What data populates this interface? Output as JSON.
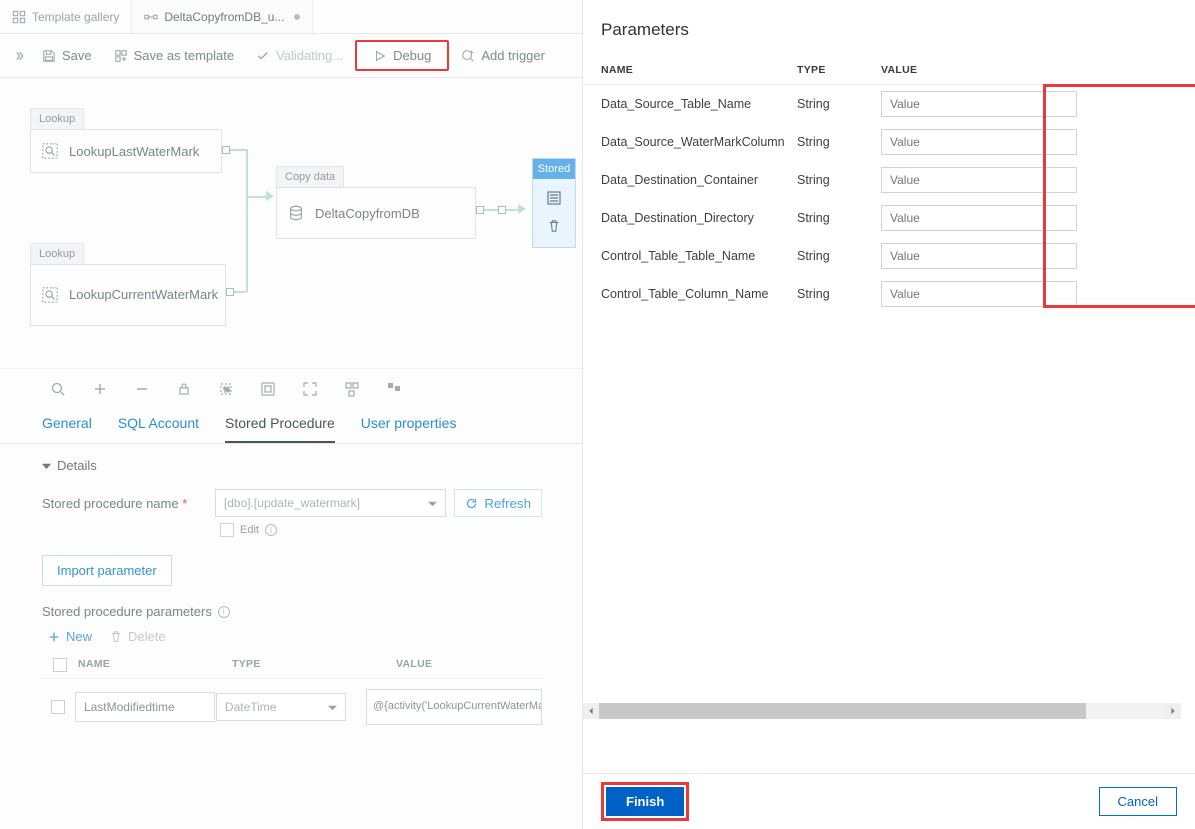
{
  "tabs": {
    "gallery": "Template gallery",
    "pipeline": "DeltaCopyfromDB_u..."
  },
  "toolbar": {
    "save": "Save",
    "save_template": "Save as template",
    "validating": "Validating...",
    "debug": "Debug",
    "add_trigger": "Add trigger"
  },
  "canvas": {
    "lookup_label": "Lookup",
    "lookup_last": "LookupLastWaterMark",
    "lookup_current": "LookupCurrentWaterMark",
    "copy_label": "Copy data",
    "copy_name": "DeltaCopyfromDB",
    "stored_label": "Stored"
  },
  "prop_tabs": {
    "general": "General",
    "sql": "SQL Account",
    "sproc": "Stored Procedure",
    "user": "User properties"
  },
  "details": {
    "header": "Details",
    "sp_name_label": "Stored procedure name",
    "sp_name_value": "[dbo].[update_watermark]",
    "edit": "Edit",
    "refresh": "Refresh",
    "import": "Import parameter",
    "sp_params_label": "Stored procedure parameters",
    "new": "New",
    "delete": "Delete",
    "col_name": "NAME",
    "col_type": "TYPE",
    "col_value": "VALUE",
    "row": {
      "name": "LastModifiedtime",
      "type": "DateTime",
      "value": "@{activity('LookupCurrentWaterMark').output.firstRow.NewWatermarkValue}"
    }
  },
  "panel": {
    "title": "Parameters",
    "col_name": "NAME",
    "col_type": "TYPE",
    "col_value": "VALUE",
    "placeholder": "Value",
    "rows": [
      {
        "name": "Data_Source_Table_Name",
        "type": "String"
      },
      {
        "name": "Data_Source_WaterMarkColumn",
        "type": "String"
      },
      {
        "name": "Data_Destination_Container",
        "type": "String"
      },
      {
        "name": "Data_Destination_Directory",
        "type": "String"
      },
      {
        "name": "Control_Table_Table_Name",
        "type": "String"
      },
      {
        "name": "Control_Table_Column_Name",
        "type": "String"
      }
    ],
    "finish": "Finish",
    "cancel": "Cancel"
  }
}
